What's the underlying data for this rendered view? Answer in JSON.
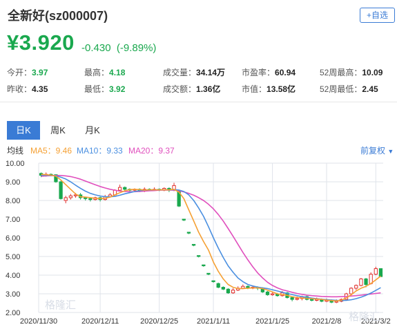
{
  "header": {
    "title": "全新好(sz000007)",
    "add_button": "+自选",
    "price": "¥3.920",
    "change": "-0.430",
    "change_pct": "(-9.89%)"
  },
  "stats": {
    "open_label": "今开：",
    "open_value": "3.97",
    "prev_close_label": "昨收：",
    "prev_close_value": "4.35",
    "high_label": "最高：",
    "high_value": "4.18",
    "low_label": "最低：",
    "low_value": "3.92",
    "volume_label": "成交量：",
    "volume_value": "34.14万",
    "turnover_label": "成交额：",
    "turnover_value": "1.36亿",
    "pe_label": "市盈率：",
    "pe_value": "60.94",
    "mcap_label": "市值：",
    "mcap_value": "13.58亿",
    "w52_high_label": "52周最高：",
    "w52_high_value": "10.09",
    "w52_low_label": "52周最低：",
    "w52_low_value": "2.45"
  },
  "tabs": {
    "day": "日K",
    "week": "周K",
    "month": "月K",
    "active": "day"
  },
  "legend": {
    "prefix": "均线",
    "ma5": "MA5：9.46",
    "ma10": "MA10：9.33",
    "ma20": "MA20：9.37",
    "adjust": "前复权"
  },
  "watermark": "格隆汇",
  "colors": {
    "up": "#e0302d",
    "down": "#1aa84e",
    "ma5": "#f5a033",
    "ma10": "#4a8fe0",
    "ma20": "#e04fbd",
    "accent": "#3a7bd5",
    "grid": "#dfe3ea"
  },
  "chart_data": {
    "type": "candlestick",
    "ylim": [
      2.0,
      10.0
    ],
    "y_ticks": [
      "10.00",
      "9.00",
      "8.00",
      "7.00",
      "6.00",
      "5.00",
      "4.00",
      "3.00",
      "2.00"
    ],
    "x_ticks": [
      "2020/11/30",
      "2020/12/11",
      "2020/12/25",
      "2021/1/11",
      "2021/1/25",
      "2021/2/8",
      "2021/3/2"
    ],
    "series_names": [
      "MA5",
      "MA10",
      "MA20"
    ],
    "candles": [
      {
        "o": 9.45,
        "c": 9.35,
        "h": 9.5,
        "l": 9.25
      },
      {
        "o": 9.35,
        "c": 9.4,
        "h": 9.5,
        "l": 9.28
      },
      {
        "o": 9.4,
        "c": 9.38,
        "h": 9.45,
        "l": 9.3
      },
      {
        "o": 9.38,
        "c": 9.0,
        "h": 9.4,
        "l": 8.95
      },
      {
        "o": 9.0,
        "c": 8.1,
        "h": 9.05,
        "l": 8.05
      },
      {
        "o": 8.0,
        "c": 8.15,
        "h": 8.25,
        "l": 7.85
      },
      {
        "o": 8.15,
        "c": 8.25,
        "h": 8.35,
        "l": 8.05
      },
      {
        "o": 8.25,
        "c": 8.3,
        "h": 8.4,
        "l": 8.15
      },
      {
        "o": 8.3,
        "c": 8.15,
        "h": 8.4,
        "l": 8.05
      },
      {
        "o": 8.15,
        "c": 8.1,
        "h": 8.2,
        "l": 8.0
      },
      {
        "o": 8.1,
        "c": 8.05,
        "h": 8.15,
        "l": 7.95
      },
      {
        "o": 8.05,
        "c": 8.15,
        "h": 8.2,
        "l": 8.0
      },
      {
        "o": 8.15,
        "c": 8.05,
        "h": 8.2,
        "l": 7.95
      },
      {
        "o": 8.05,
        "c": 8.2,
        "h": 8.3,
        "l": 8.0
      },
      {
        "o": 8.2,
        "c": 8.3,
        "h": 8.4,
        "l": 8.15
      },
      {
        "o": 8.3,
        "c": 8.55,
        "h": 8.6,
        "l": 8.25
      },
      {
        "o": 8.55,
        "c": 8.7,
        "h": 8.85,
        "l": 8.5
      },
      {
        "o": 8.7,
        "c": 8.6,
        "h": 8.75,
        "l": 8.5
      },
      {
        "o": 8.6,
        "c": 8.55,
        "h": 8.65,
        "l": 8.5
      },
      {
        "o": 8.55,
        "c": 8.6,
        "h": 8.65,
        "l": 8.5
      },
      {
        "o": 8.6,
        "c": 8.5,
        "h": 8.65,
        "l": 8.45
      },
      {
        "o": 8.5,
        "c": 8.6,
        "h": 8.7,
        "l": 8.45
      },
      {
        "o": 8.6,
        "c": 8.55,
        "h": 8.65,
        "l": 8.5
      },
      {
        "o": 8.55,
        "c": 8.6,
        "h": 8.7,
        "l": 8.5
      },
      {
        "o": 8.6,
        "c": 8.55,
        "h": 8.65,
        "l": 8.5
      },
      {
        "o": 8.55,
        "c": 8.65,
        "h": 8.7,
        "l": 8.5
      },
      {
        "o": 8.65,
        "c": 8.55,
        "h": 8.7,
        "l": 8.45
      },
      {
        "o": 8.55,
        "c": 8.8,
        "h": 8.95,
        "l": 8.5
      },
      {
        "o": 8.5,
        "c": 7.7,
        "h": 8.55,
        "l": 7.65
      },
      {
        "o": 7.0,
        "c": 6.95,
        "h": 7.0,
        "l": 6.9
      },
      {
        "o": 6.3,
        "c": 6.25,
        "h": 6.3,
        "l": 6.2
      },
      {
        "o": 5.65,
        "c": 5.6,
        "h": 5.65,
        "l": 5.55
      },
      {
        "o": 5.05,
        "c": 5.0,
        "h": 5.05,
        "l": 4.95
      },
      {
        "o": 4.55,
        "c": 4.5,
        "h": 4.55,
        "l": 4.45
      },
      {
        "o": 4.1,
        "c": 4.05,
        "h": 4.1,
        "l": 4.0
      },
      {
        "o": 3.7,
        "c": 3.65,
        "h": 3.7,
        "l": 3.6
      },
      {
        "o": 3.55,
        "c": 3.35,
        "h": 3.6,
        "l": 3.3
      },
      {
        "o": 3.35,
        "c": 3.25,
        "h": 3.4,
        "l": 3.2
      },
      {
        "o": 3.25,
        "c": 3.05,
        "h": 3.3,
        "l": 3.0
      },
      {
        "o": 3.05,
        "c": 3.2,
        "h": 3.3,
        "l": 3.0
      },
      {
        "o": 3.2,
        "c": 3.3,
        "h": 3.4,
        "l": 3.15
      },
      {
        "o": 3.3,
        "c": 3.4,
        "h": 3.5,
        "l": 3.25
      },
      {
        "o": 3.4,
        "c": 3.3,
        "h": 3.45,
        "l": 3.25
      },
      {
        "o": 3.3,
        "c": 3.35,
        "h": 3.45,
        "l": 3.25
      },
      {
        "o": 3.35,
        "c": 3.3,
        "h": 3.4,
        "l": 3.2
      },
      {
        "o": 3.3,
        "c": 3.1,
        "h": 3.35,
        "l": 3.05
      },
      {
        "o": 3.1,
        "c": 2.95,
        "h": 3.15,
        "l": 2.9
      },
      {
        "o": 2.95,
        "c": 3.0,
        "h": 3.1,
        "l": 2.9
      },
      {
        "o": 3.0,
        "c": 2.9,
        "h": 3.05,
        "l": 2.85
      },
      {
        "o": 2.9,
        "c": 3.05,
        "h": 3.15,
        "l": 2.85
      },
      {
        "o": 3.05,
        "c": 2.8,
        "h": 3.1,
        "l": 2.75
      },
      {
        "o": 2.8,
        "c": 2.7,
        "h": 2.85,
        "l": 2.6
      },
      {
        "o": 2.7,
        "c": 2.75,
        "h": 2.85,
        "l": 2.65
      },
      {
        "o": 2.75,
        "c": 2.85,
        "h": 2.9,
        "l": 2.65
      },
      {
        "o": 2.85,
        "c": 2.7,
        "h": 2.9,
        "l": 2.65
      },
      {
        "o": 2.7,
        "c": 2.65,
        "h": 2.75,
        "l": 2.6
      },
      {
        "o": 2.65,
        "c": 2.7,
        "h": 2.8,
        "l": 2.6
      },
      {
        "o": 2.7,
        "c": 2.6,
        "h": 2.75,
        "l": 2.55
      },
      {
        "o": 2.6,
        "c": 2.65,
        "h": 2.75,
        "l": 2.55
      },
      {
        "o": 2.65,
        "c": 2.55,
        "h": 2.7,
        "l": 2.5
      },
      {
        "o": 2.55,
        "c": 2.6,
        "h": 2.7,
        "l": 2.5
      },
      {
        "o": 2.6,
        "c": 2.7,
        "h": 2.75,
        "l": 2.55
      },
      {
        "o": 2.7,
        "c": 3.0,
        "h": 3.05,
        "l": 2.65
      },
      {
        "o": 3.0,
        "c": 3.3,
        "h": 3.35,
        "l": 2.95
      },
      {
        "o": 3.3,
        "c": 3.45,
        "h": 3.5,
        "l": 3.2
      },
      {
        "o": 3.45,
        "c": 3.8,
        "h": 3.85,
        "l": 3.4
      },
      {
        "o": 3.8,
        "c": 3.5,
        "h": 3.85,
        "l": 3.35
      },
      {
        "o": 3.55,
        "c": 4.05,
        "h": 4.15,
        "l": 3.5
      },
      {
        "o": 4.05,
        "c": 4.35,
        "h": 4.45,
        "l": 4.0
      },
      {
        "o": 4.35,
        "c": 3.92,
        "h": 4.18,
        "l": 3.92
      }
    ],
    "ma5": [
      9.4,
      9.38,
      9.36,
      9.3,
      9.1,
      8.85,
      8.6,
      8.35,
      8.2,
      8.18,
      8.15,
      8.12,
      8.1,
      8.12,
      8.18,
      8.3,
      8.42,
      8.52,
      8.58,
      8.6,
      8.58,
      8.56,
      8.57,
      8.57,
      8.57,
      8.57,
      8.57,
      8.6,
      8.45,
      8.1,
      7.5,
      6.9,
      6.3,
      5.8,
      5.35,
      4.7,
      4.2,
      3.8,
      3.5,
      3.35,
      3.28,
      3.28,
      3.3,
      3.32,
      3.32,
      3.28,
      3.2,
      3.1,
      3.0,
      2.96,
      2.92,
      2.85,
      2.8,
      2.78,
      2.76,
      2.74,
      2.72,
      2.7,
      2.66,
      2.64,
      2.62,
      2.66,
      2.78,
      2.95,
      3.15,
      3.3,
      3.4,
      3.55,
      3.75,
      3.95
    ],
    "ma10": [
      9.35,
      9.35,
      9.34,
      9.32,
      9.25,
      9.15,
      9.0,
      8.82,
      8.65,
      8.5,
      8.38,
      8.3,
      8.24,
      8.2,
      8.2,
      8.22,
      8.28,
      8.36,
      8.42,
      8.48,
      8.52,
      8.55,
      8.56,
      8.57,
      8.57,
      8.57,
      8.57,
      8.58,
      8.56,
      8.48,
      8.3,
      8.0,
      7.6,
      7.15,
      6.6,
      6.0,
      5.45,
      4.95,
      4.5,
      4.15,
      3.85,
      3.65,
      3.5,
      3.42,
      3.36,
      3.32,
      3.28,
      3.22,
      3.15,
      3.08,
      3.02,
      2.96,
      2.9,
      2.85,
      2.81,
      2.77,
      2.74,
      2.71,
      2.69,
      2.67,
      2.65,
      2.64,
      2.65,
      2.68,
      2.74,
      2.82,
      2.92,
      3.04,
      3.18,
      3.33
    ],
    "ma20": [
      9.3,
      9.32,
      9.33,
      9.34,
      9.34,
      9.32,
      9.28,
      9.22,
      9.14,
      9.04,
      8.94,
      8.84,
      8.75,
      8.67,
      8.6,
      8.55,
      8.5,
      8.48,
      8.47,
      8.47,
      8.48,
      8.5,
      8.52,
      8.53,
      8.55,
      8.56,
      8.56,
      8.55,
      8.52,
      8.46,
      8.38,
      8.28,
      8.15,
      8.0,
      7.8,
      7.55,
      7.25,
      6.9,
      6.5,
      6.08,
      5.65,
      5.22,
      4.82,
      4.45,
      4.12,
      3.85,
      3.62,
      3.45,
      3.32,
      3.22,
      3.15,
      3.08,
      3.02,
      2.97,
      2.93,
      2.9,
      2.88,
      2.86,
      2.85,
      2.84,
      2.84,
      2.85,
      2.86,
      2.88,
      2.9,
      2.93,
      2.96,
      2.99,
      3.02,
      3.05
    ]
  }
}
